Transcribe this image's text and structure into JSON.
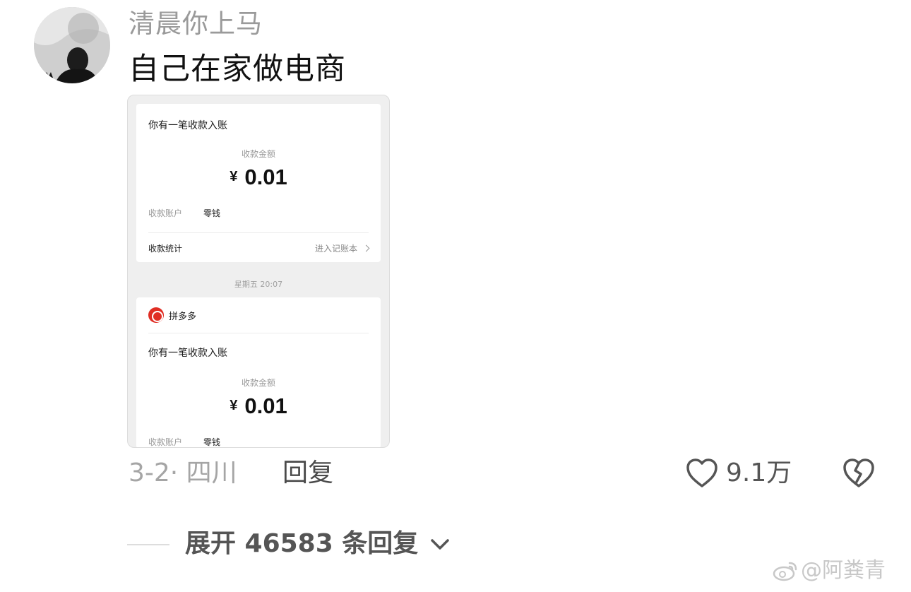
{
  "comment": {
    "username": "清晨你上马",
    "text": "自己在家做电商",
    "date_location": "3-2· 四川",
    "reply_label": "回复",
    "like_count": "9.1万",
    "expand_replies": "展开 46583 条回复"
  },
  "screenshot": {
    "card1": {
      "title": "你有一笔收款入账",
      "amount_label": "收款金额",
      "currency": "¥",
      "amount": "0.01",
      "account_label": "收款账户",
      "account_value": "零钱",
      "stats_label": "收款统计",
      "stats_link": "进入记账本"
    },
    "timestamp": "星期五 20:07",
    "card2": {
      "app_name": "拼多多",
      "title": "你有一笔收款入账",
      "amount_label": "收款金额",
      "currency": "¥",
      "amount": "0.01",
      "account_label": "收款账户",
      "account_value": "零钱"
    }
  },
  "watermark": "@阿粪青",
  "colors": {
    "pdd_red": "#e02e24",
    "meta_gray": "#a5a5a5",
    "text_dark": "#111111"
  },
  "icons": {
    "like": "heart-outline-icon",
    "dislike": "broken-heart-icon",
    "expand": "chevron-down-icon",
    "watermark": "weibo-icon"
  }
}
